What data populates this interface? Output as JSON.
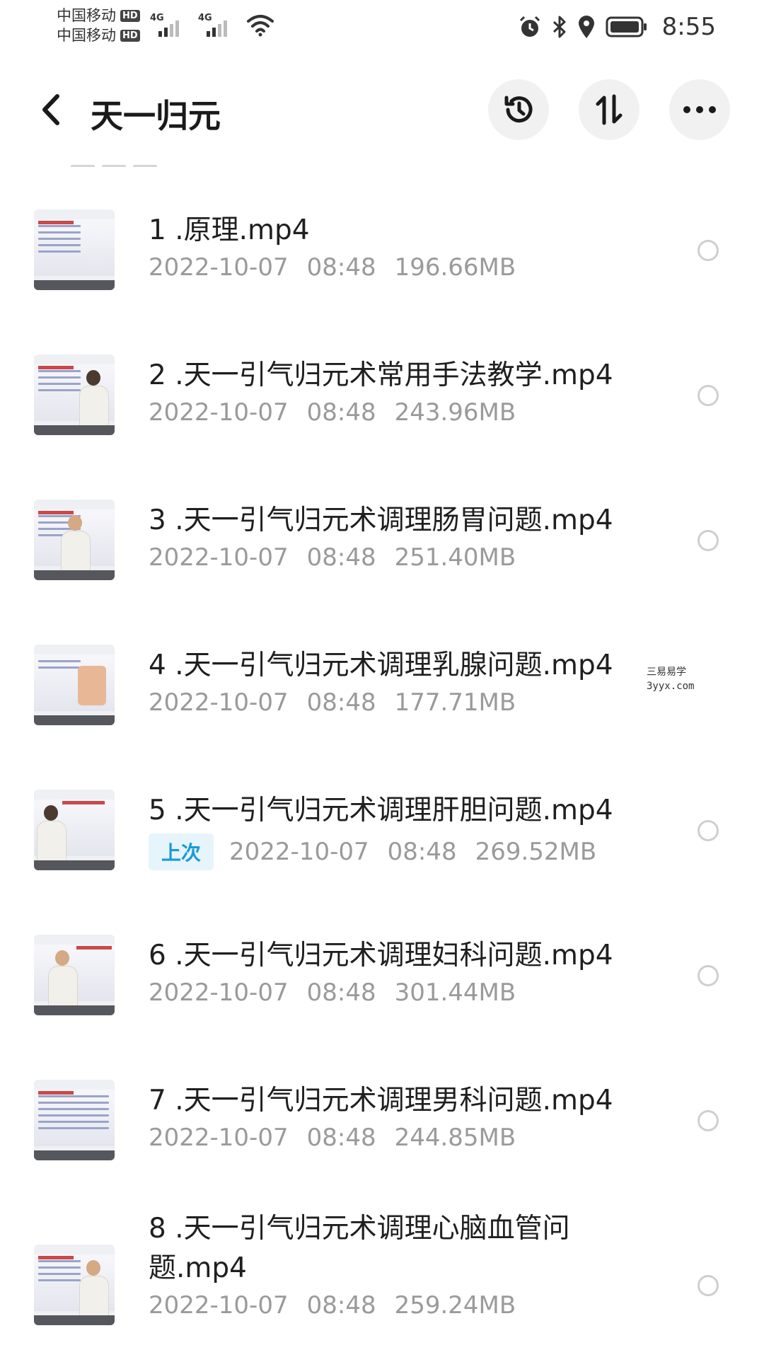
{
  "status_bar": {
    "carrier_1": "中国移动",
    "carrier_2": "中国移动",
    "hd": "HD",
    "network_1": "4G",
    "network_2": "4G",
    "time": "8:55"
  },
  "header": {
    "title": "天一归元"
  },
  "files": [
    {
      "name": "1 .原理.mp4",
      "date": "2022-10-07",
      "time": "08:48",
      "size": "196.66MB",
      "badge": ""
    },
    {
      "name": "2 .天一引气归元术常用手法教学.mp4",
      "date": "2022-10-07",
      "time": "08:48",
      "size": "243.96MB",
      "badge": ""
    },
    {
      "name": "3 .天一引气归元术调理肠胃问题.mp4",
      "date": "2022-10-07",
      "time": "08:48",
      "size": "251.40MB",
      "badge": ""
    },
    {
      "name": "4 .天一引气归元术调理乳腺问题.mp4",
      "date": "2022-10-07",
      "time": "08:48",
      "size": "177.71MB",
      "badge": ""
    },
    {
      "name": "5 .天一引气归元术调理肝胆问题.mp4",
      "date": "2022-10-07",
      "time": "08:48",
      "size": "269.52MB",
      "badge": "上次"
    },
    {
      "name": "6 .天一引气归元术调理妇科问题.mp4",
      "date": "2022-10-07",
      "time": "08:48",
      "size": "301.44MB",
      "badge": ""
    },
    {
      "name": "7 .天一引气归元术调理男科问题.mp4",
      "date": "2022-10-07",
      "time": "08:48",
      "size": "244.85MB",
      "badge": ""
    },
    {
      "name": "8 .天一引气归元术调理心脑血管问题.mp4",
      "date": "2022-10-07",
      "time": "08:48",
      "size": "259.24MB",
      "badge": ""
    }
  ],
  "watermark": {
    "line1": "三易易学",
    "line2": "3yyx.com"
  }
}
